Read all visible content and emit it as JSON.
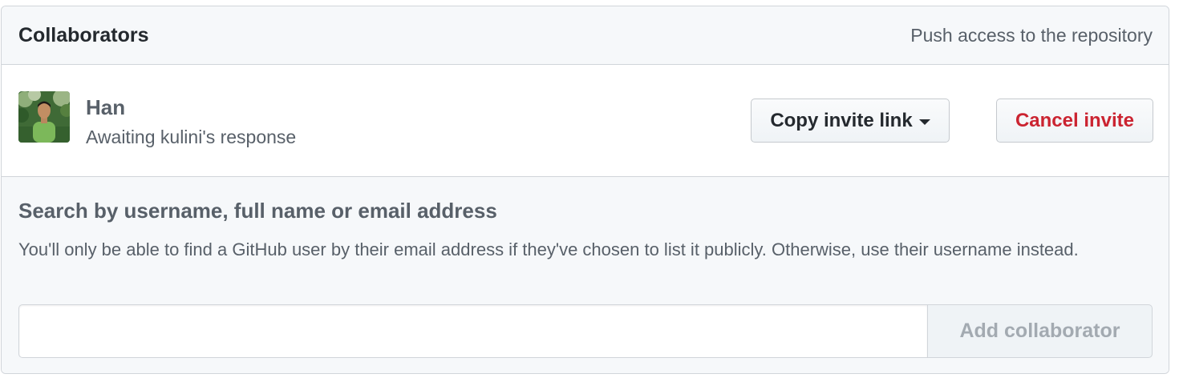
{
  "header": {
    "title": "Collaborators",
    "note": "Push access to the repository"
  },
  "invite": {
    "name": "Han",
    "status": "Awaiting kulini's response",
    "avatar_icon": "user-avatar",
    "copy_label": "Copy invite link",
    "cancel_label": "Cancel invite"
  },
  "search": {
    "title": "Search by username, full name or email address",
    "help": "You'll only be able to find a GitHub user by their email address if they've chosen to list it publicly. Otherwise, use their username instead.",
    "input_value": "",
    "add_label": "Add collaborator"
  },
  "colors": {
    "danger": "#cb2431",
    "muted": "#586069",
    "border": "#d1d5da",
    "header_bg": "#f6f8fa"
  }
}
